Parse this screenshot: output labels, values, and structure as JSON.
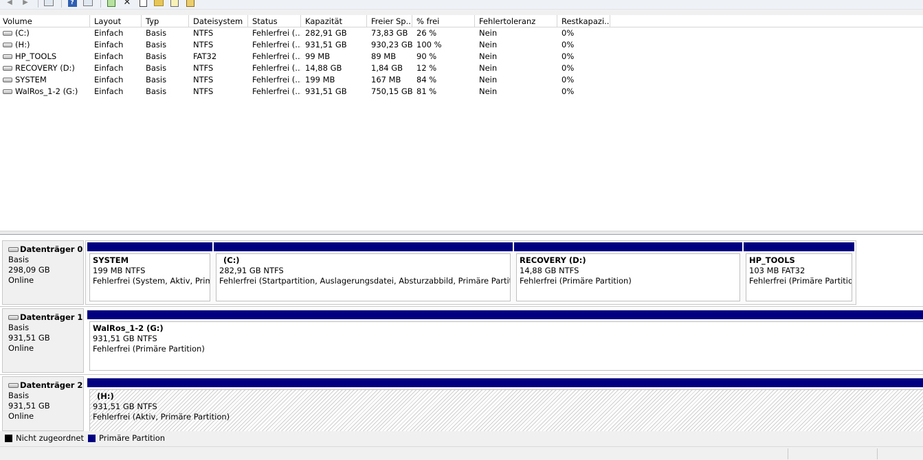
{
  "toolbar": {
    "back_icon": "arrow-left-icon",
    "forward_icon": "arrow-right-icon"
  },
  "volume_list": {
    "columns": [
      "Volume",
      "Layout",
      "Typ",
      "Dateisystem",
      "Status",
      "Kapazität",
      "Freier Sp...",
      "% frei",
      "Fehlertoleranz",
      "Restkapazi..."
    ],
    "rows": [
      [
        "(C:)",
        "Einfach",
        "Basis",
        "NTFS",
        "Fehlerfrei (...",
        "282,91 GB",
        "73,83 GB",
        "26 %",
        "Nein",
        "0%"
      ],
      [
        "(H:)",
        "Einfach",
        "Basis",
        "NTFS",
        "Fehlerfrei (...",
        "931,51 GB",
        "930,23 GB",
        "100 %",
        "Nein",
        "0%"
      ],
      [
        "HP_TOOLS",
        "Einfach",
        "Basis",
        "FAT32",
        "Fehlerfrei (...",
        "99 MB",
        "89 MB",
        "90 %",
        "Nein",
        "0%"
      ],
      [
        "RECOVERY (D:)",
        "Einfach",
        "Basis",
        "NTFS",
        "Fehlerfrei (...",
        "14,88 GB",
        "1,84 GB",
        "12 %",
        "Nein",
        "0%"
      ],
      [
        "SYSTEM",
        "Einfach",
        "Basis",
        "NTFS",
        "Fehlerfrei (...",
        "199 MB",
        "167 MB",
        "84 %",
        "Nein",
        "0%"
      ],
      [
        "WalRos_1-2 (G:)",
        "Einfach",
        "Basis",
        "NTFS",
        "Fehlerfrei (...",
        "931,51 GB",
        "750,15 GB",
        "81 %",
        "Nein",
        "0%"
      ]
    ]
  },
  "disks": [
    {
      "name": "Datenträger 0",
      "type": "Basis",
      "size": "298,09 GB",
      "state": "Online",
      "partitions": [
        {
          "title": "SYSTEM",
          "size": "199 MB NTFS",
          "status": "Fehlerfrei (System, Aktiv, Primär"
        },
        {
          "title": "(C:)",
          "size": "282,91 GB NTFS",
          "status": "Fehlerfrei (Startpartition, Auslagerungsdatei, Absturzabbild, Primäre Partition)"
        },
        {
          "title": "RECOVERY  (D:)",
          "size": "14,88 GB NTFS",
          "status": "Fehlerfrei (Primäre Partition)"
        },
        {
          "title": "HP_TOOLS",
          "size": "103 MB FAT32",
          "status": "Fehlerfrei (Primäre Partition)"
        }
      ]
    },
    {
      "name": "Datenträger 1",
      "type": "Basis",
      "size": "931,51 GB",
      "state": "Online",
      "partitions": [
        {
          "title": "WalRos_1-2  (G:)",
          "size": "931,51 GB NTFS",
          "status": "Fehlerfrei (Primäre Partition)"
        }
      ]
    },
    {
      "name": "Datenträger 2",
      "type": "Basis",
      "size": "931,51 GB",
      "state": "Online",
      "partitions": [
        {
          "title": "(H:)",
          "size": "931,51 GB NTFS",
          "status": "Fehlerfrei (Aktiv, Primäre Partition)"
        }
      ]
    }
  ],
  "legend": {
    "unallocated": "Nicht zugeordnet",
    "unallocated_color": "#000000",
    "primary": "Primäre Partition",
    "primary_color": "#000080"
  }
}
